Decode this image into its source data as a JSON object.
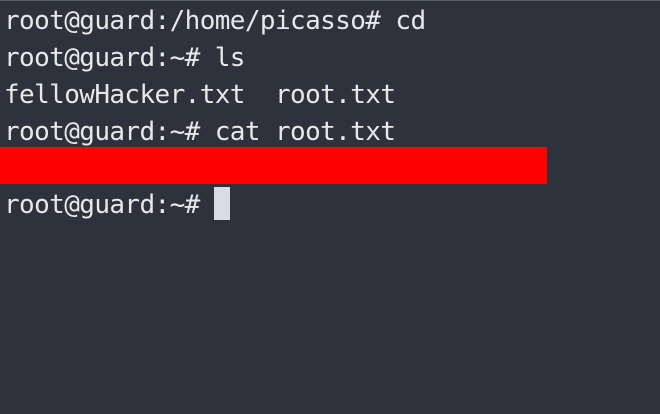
{
  "terminal": {
    "lines": [
      "root@guard:/home/picasso# cd",
      "root@guard:~# ls",
      "fellowHacker.txt  root.txt",
      "root@guard:~# cat root.txt"
    ],
    "prompt": "root@guard:~#",
    "colors": {
      "background": "#2d323c",
      "text": "#e8e8e8",
      "redaction": "#ff0000",
      "cursor": "#d8dce3"
    }
  }
}
